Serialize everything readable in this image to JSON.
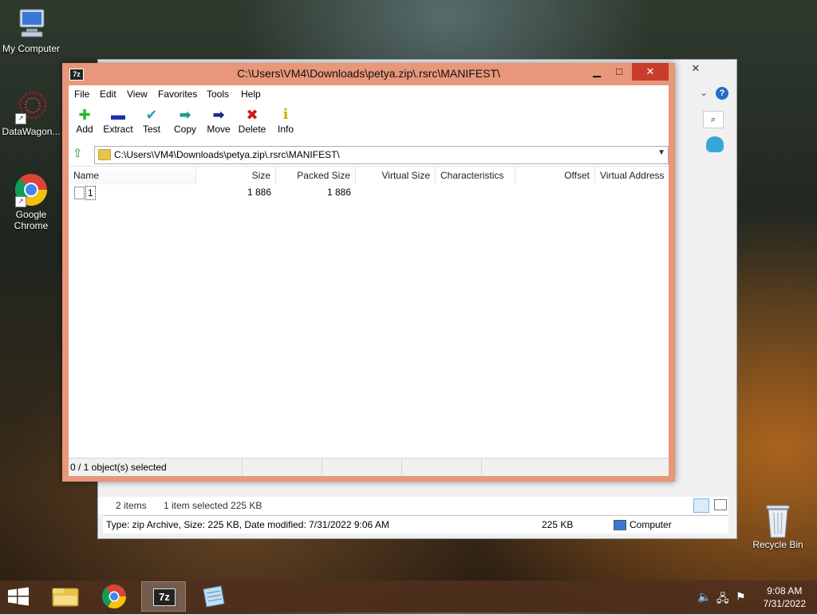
{
  "desktop": {
    "icons": [
      {
        "label": "My Computer"
      },
      {
        "label": "DataWagon..."
      },
      {
        "label": "Google Chrome"
      },
      {
        "label": "Recycle Bin"
      }
    ]
  },
  "bg_window": {
    "items_count": "2 items",
    "items_selected": "1 item selected  225 KB",
    "status_text": "Type: zip Archive, Size: 225 KB, Date modified: 7/31/2022 9:06 AM",
    "status_size": "225 KB",
    "status_location": "Computer"
  },
  "window": {
    "title": "C:\\Users\\VM4\\Downloads\\petya.zip\\.rsrc\\MANIFEST\\",
    "logo": "7z"
  },
  "menu": [
    "File",
    "Edit",
    "View",
    "Favorites",
    "Tools",
    "Help"
  ],
  "toolbar": [
    {
      "label": "Add",
      "icon": "plus-icon",
      "color": "#2fb52f"
    },
    {
      "label": "Extract",
      "icon": "minus-icon",
      "color": "#1d2fb0"
    },
    {
      "label": "Test",
      "icon": "check-icon",
      "color": "#25a8b8"
    },
    {
      "label": "Copy",
      "icon": "copy-arrow-icon",
      "color": "#1f9a8a"
    },
    {
      "label": "Move",
      "icon": "move-arrow-icon",
      "color": "#1d2a8a"
    },
    {
      "label": "Delete",
      "icon": "x-icon",
      "color": "#d01818"
    },
    {
      "label": "Info",
      "icon": "info-icon",
      "color": "#c8b400"
    }
  ],
  "address": {
    "path": "C:\\Users\\VM4\\Downloads\\petya.zip\\.rsrc\\MANIFEST\\"
  },
  "columns": [
    "Name",
    "Size",
    "Packed Size",
    "Virtual Size",
    "Characteristics",
    "Offset",
    "Virtual Address"
  ],
  "rows": [
    {
      "name": "1",
      "size": "1 886",
      "packed": "1 886",
      "virtual_size": "",
      "characteristics": "",
      "offset": "",
      "virtual_address": ""
    }
  ],
  "status": {
    "selected": "0 / 1 object(s) selected"
  },
  "clock": {
    "time": "9:08 AM",
    "date": "7/31/2022"
  }
}
